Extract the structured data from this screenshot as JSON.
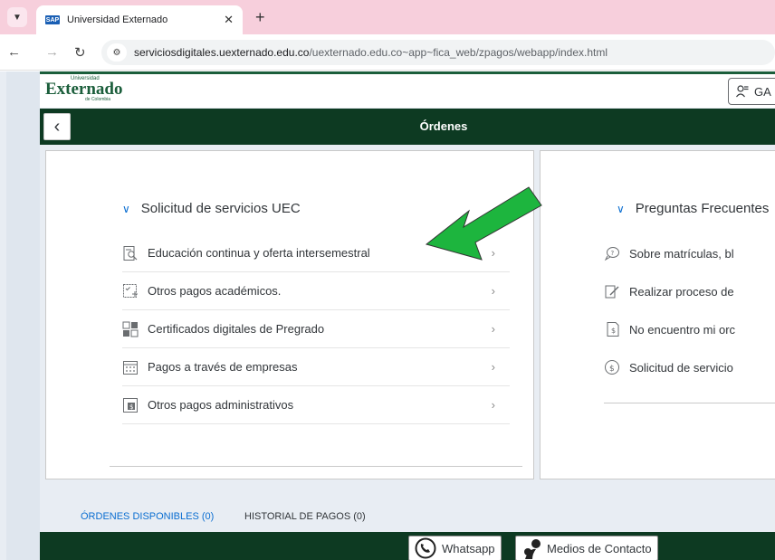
{
  "browser": {
    "tab_title": "Universidad Externado",
    "tab_favicon_text": "SAP",
    "url_host": "serviciosdigitales.uexternado.edu.co",
    "url_path": "/uexternado.edu.co~app~fica_web/zpagos/webapp/index.html"
  },
  "header": {
    "logo_top": "Universidad",
    "logo_main": "Externado",
    "logo_sub": "de Colombia",
    "user_initials": "GA"
  },
  "subheader": {
    "title": "Órdenes"
  },
  "left_panel": {
    "section_title": "Solicitud de servicios UEC",
    "items": [
      {
        "label": "Educación continua y oferta intersemestral",
        "icon": "search-document-icon"
      },
      {
        "label": "Otros pagos académicos.",
        "icon": "checklist-add-icon"
      },
      {
        "label": "Certificados digitales de Pregrado",
        "icon": "certificate-grid-icon"
      },
      {
        "label": "Pagos a través de empresas",
        "icon": "calendar-grid-icon"
      },
      {
        "label": "Otros pagos administrativos",
        "icon": "document-money-icon"
      }
    ]
  },
  "right_panel": {
    "section_title": "Preguntas Frecuentes",
    "items": [
      {
        "label": "Sobre matrículas, bl",
        "icon": "chat-question-icon"
      },
      {
        "label": "Realizar proceso de",
        "icon": "edit-document-icon"
      },
      {
        "label": "No encuentro mi orc",
        "icon": "document-money-icon"
      },
      {
        "label": "Solicitud de servicio",
        "icon": "dollar-circle-icon"
      }
    ]
  },
  "tabs": {
    "available": "ÓRDENES DISPONIBLES (0)",
    "history": "HISTORIAL DE PAGOS (0)"
  },
  "footer": {
    "whatsapp": "Whatsapp",
    "contact": "Medios de Contacto"
  },
  "colors": {
    "brand_green": "#0d3a22",
    "accent_blue": "#0a6ed1",
    "annotation_arrow": "#1db53e"
  }
}
